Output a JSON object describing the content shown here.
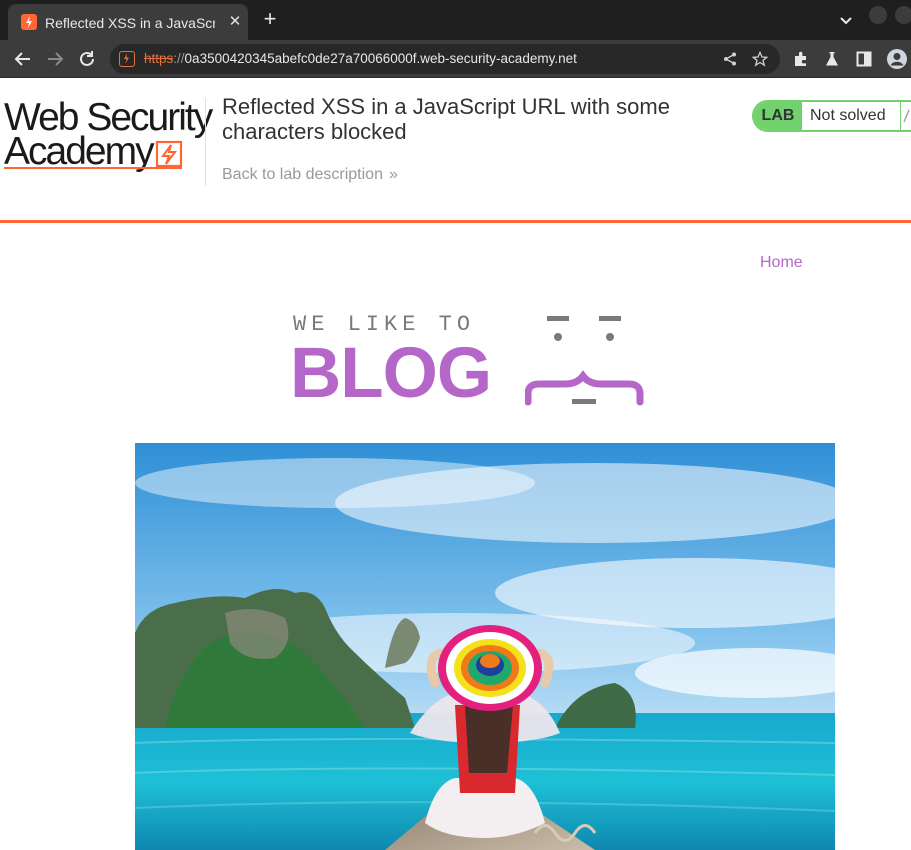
{
  "browser": {
    "tab_title": "Reflected XSS in a JavaScript URL with some characters blocked",
    "tab_close": "✕",
    "new_tab": "+",
    "url_scheme": "https",
    "url_separator": "://",
    "url_host": "0a3500420345abefc0de27a70066000f.web-security-academy.net"
  },
  "lab_header": {
    "logo_line1": "Web Security",
    "logo_line2": "Academy",
    "title": "Reflected XSS in a JavaScript URL with some characters blocked",
    "back_link": "Back to lab description",
    "back_chevron": "»",
    "badge_label": "LAB",
    "badge_status": "Not solved"
  },
  "blog": {
    "nav_home": "Home",
    "banner_small": "WE LIKE TO",
    "banner_big": "BLOG"
  },
  "colors": {
    "accent_orange": "#ff6633",
    "blog_purple": "#b467c9",
    "lab_green": "#70d16d"
  }
}
